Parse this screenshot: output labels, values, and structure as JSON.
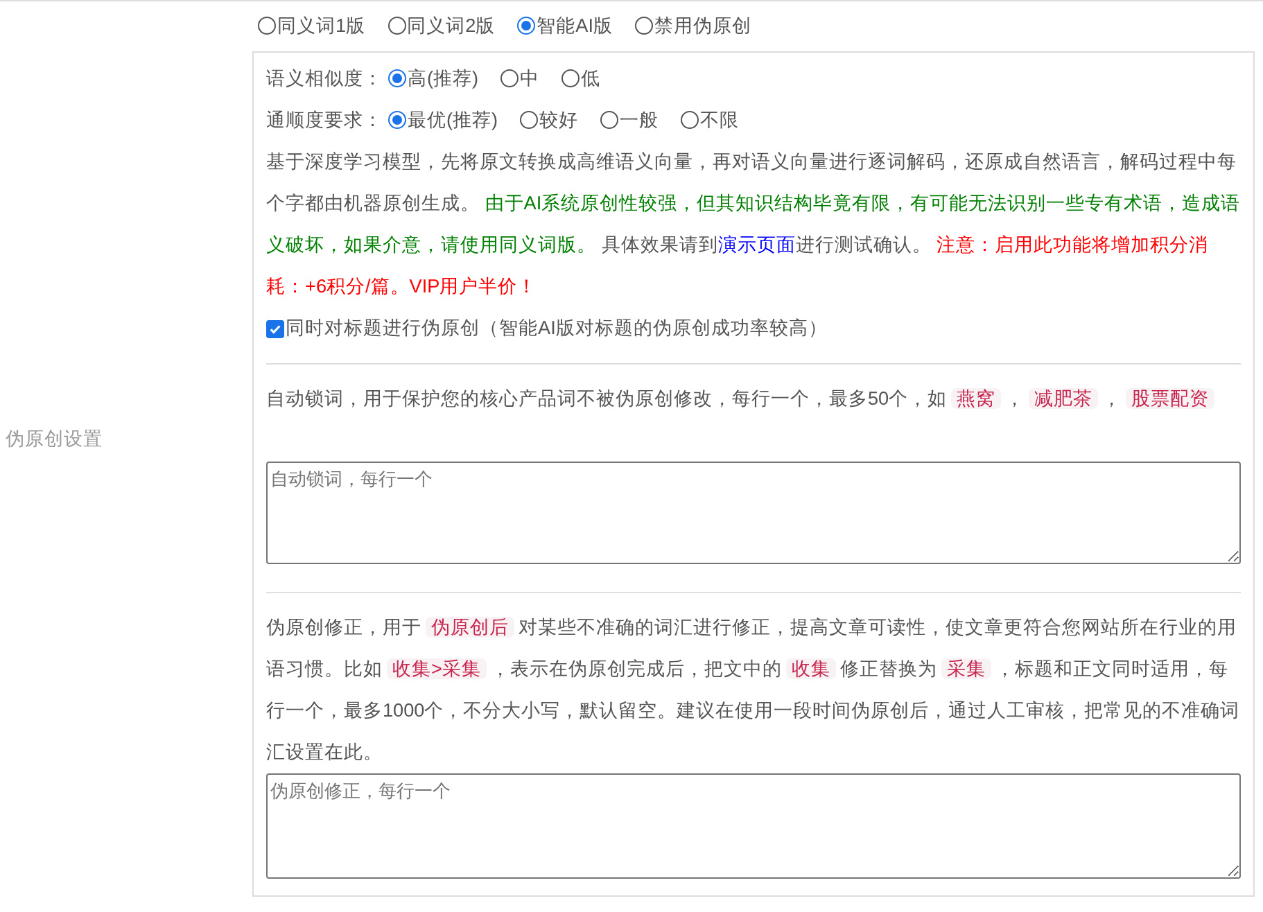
{
  "side_label": "伪原创设置",
  "modes": [
    {
      "label": "同义词1版",
      "selected": false
    },
    {
      "label": "同义词2版",
      "selected": false
    },
    {
      "label": "智能AI版",
      "selected": true
    },
    {
      "label": "禁用伪原创",
      "selected": false
    }
  ],
  "option_groups": [
    {
      "label": "语义相似度：",
      "options": [
        {
          "label": "高(推荐)",
          "selected": true
        },
        {
          "label": "中",
          "selected": false
        },
        {
          "label": "低",
          "selected": false
        }
      ]
    },
    {
      "label": "通顺度要求：",
      "options": [
        {
          "label": "最优(推荐)",
          "selected": true
        },
        {
          "label": "较好",
          "selected": false
        },
        {
          "label": "一般",
          "selected": false
        },
        {
          "label": "不限",
          "selected": false
        }
      ]
    }
  ],
  "ai_description": [
    {
      "kind": "plain",
      "text": "基于深度学习模型，先将原文转换成高维语义向量，再对语义向量进行逐词解码，还原成自然语言，解码过程中每个字都由机器原创生成。 "
    },
    {
      "kind": "green",
      "text": "由于AI系统原创性较强，但其知识结构毕竟有限，有可能无法识别一些专有术语，造成语义破坏，如果介意，请使用同义词版。"
    },
    {
      "kind": "plain",
      "text": " 具体效果请到"
    },
    {
      "kind": "link",
      "text": "演示页面"
    },
    {
      "kind": "plain",
      "text": "进行测试确认。 "
    },
    {
      "kind": "red",
      "text": "注意：启用此功能将增加积分消耗：+6积分/篇。VIP用户半价！"
    }
  ],
  "title_option": {
    "label": "同时对标题进行伪原创（智能AI版对标题的伪原创成功率较高）",
    "checked": true
  },
  "lock_words": {
    "description": [
      {
        "kind": "plain",
        "text": "自动锁词，用于保护您的核心产品词不被伪原创修改，每行一个，最多50个，如"
      },
      {
        "kind": "tag",
        "text": "燕窝"
      },
      {
        "kind": "plain",
        "text": "，"
      },
      {
        "kind": "tag",
        "text": "减肥茶"
      },
      {
        "kind": "plain",
        "text": "，"
      },
      {
        "kind": "tag",
        "text": "股票配资"
      }
    ],
    "placeholder": "自动锁词，每行一个"
  },
  "corrections": {
    "description": [
      {
        "kind": "plain",
        "text": "伪原创修正，用于"
      },
      {
        "kind": "tag",
        "text": "伪原创后"
      },
      {
        "kind": "plain",
        "text": "对某些不准确的词汇进行修正，提高文章可读性，使文章更符合您网站所在行业的用语习惯。比如"
      },
      {
        "kind": "tag",
        "text": "收集>采集"
      },
      {
        "kind": "plain",
        "text": "，表示在伪原创完成后，把文中的"
      },
      {
        "kind": "tag",
        "text": "收集"
      },
      {
        "kind": "plain",
        "text": "修正替换为"
      },
      {
        "kind": "tag",
        "text": "采集"
      },
      {
        "kind": "plain",
        "text": "，标题和正文同时适用，每行一个，最多1000个，不分大小写，默认留空。建议在使用一段时间伪原创后，通过人工审核，把常见的不准确词汇设置在此。"
      }
    ],
    "placeholder": "伪原创修正，每行一个"
  }
}
